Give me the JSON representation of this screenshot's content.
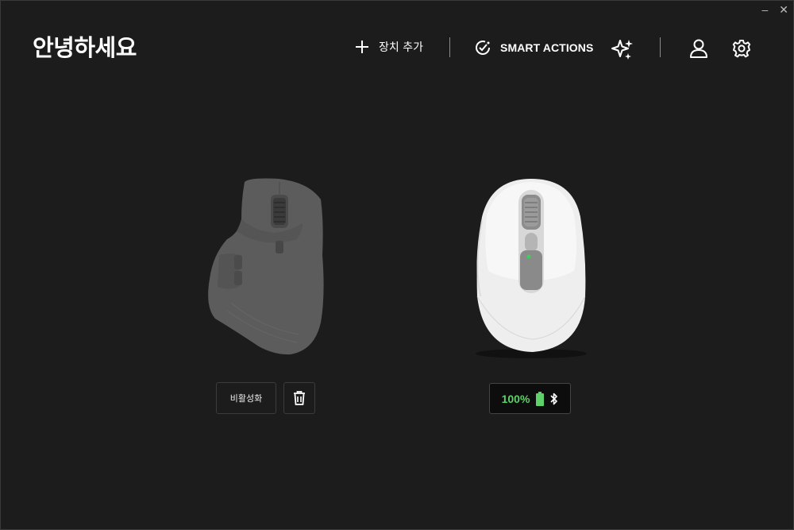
{
  "window": {
    "minimize_icon": "minimize-icon",
    "close_icon": "close-icon",
    "minimize_glyph": "–",
    "close_glyph": "✕"
  },
  "header": {
    "greeting": "안녕하세요",
    "add_device": {
      "icon": "plus-icon",
      "label": "장치 추가"
    },
    "smart_actions": {
      "icon": "smart-actions-icon",
      "label": "SMART ACTIONS"
    },
    "sparkle_icon": "sparkle-icon",
    "account_icon": "user-icon",
    "settings_icon": "gear-icon"
  },
  "devices": [
    {
      "name": "mouse-1",
      "state": "inactive",
      "deactivate_label": "비활성화",
      "delete_icon": "trash-icon"
    },
    {
      "name": "mouse-2",
      "state": "active",
      "battery_percent": "100%",
      "battery_icon": "battery-icon",
      "connection_icon": "bluetooth-icon"
    }
  ],
  "colors": {
    "background": "#1c1c1c",
    "battery_green": "#5ed16a",
    "text": "#ffffff"
  }
}
